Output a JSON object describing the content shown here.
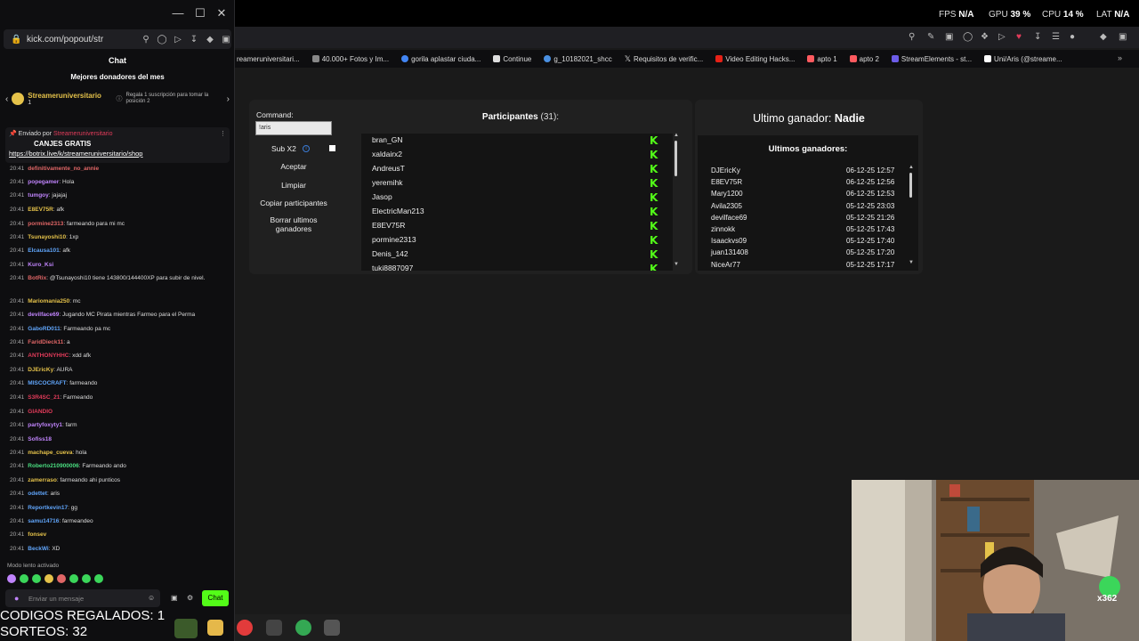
{
  "chat_window": {
    "url": "kick.com/popout/str",
    "header": "Chat",
    "donors_title": "Mejores donadores del mes",
    "donor_name": "Streameruniversitario",
    "donor_count": "1",
    "donor_hint": "Regala 1 suscripción para tomar la posición 2",
    "pinned_prefix": "Enviado por",
    "pinned_user": "Streameruniversitario",
    "pinned_title": "CANJES GRATIS",
    "pinned_link": "https://botrix.live/k/streameruniversitario/shop",
    "messages": [
      {
        "time": "20:41",
        "user": "definitivamente_no_annie",
        "color": "#e06666",
        "text": ""
      },
      {
        "time": "20:41",
        "user": "popegamer",
        "color": "#c084fc",
        "text": "Hola"
      },
      {
        "time": "20:41",
        "user": "tumgoy",
        "color": "#c084fc",
        "text": "jajajaj"
      },
      {
        "time": "20:41",
        "user": "E8EV75R",
        "color": "#e5c24a",
        "text": "afk"
      },
      {
        "time": "20:41",
        "user": "pormine2313",
        "color": "#e06666",
        "text": "farmeando para mi mc"
      },
      {
        "time": "20:41",
        "user": "Tsunayoshi10",
        "color": "#e5c24a",
        "text": "1xp"
      },
      {
        "time": "20:41",
        "user": "Elcausa101",
        "color": "#60a5fa",
        "text": "afk"
      },
      {
        "time": "20:41",
        "user": "Kuro_Ksi",
        "color": "#c084fc",
        "text": ""
      },
      {
        "time": "20:41",
        "user": "BotRix",
        "color": "#e06666",
        "text": "@Tsunayoshi10 tiene 143800/144400XP para subir de nivel."
      },
      {
        "time": "20:41",
        "user": "Mariomania250",
        "color": "#e5c24a",
        "text": "mc"
      },
      {
        "time": "20:41",
        "user": "devilface69",
        "color": "#c084fc",
        "text": "Jugando MC Pirata mientras Farmeo para el Perma"
      },
      {
        "time": "20:41",
        "user": "GaboRD011",
        "color": "#60a5fa",
        "text": "Farmeando pa mc"
      },
      {
        "time": "20:41",
        "user": "FaridDieck11",
        "color": "#e06666",
        "text": "a"
      },
      {
        "time": "20:41",
        "user": "ANTHONYHHC",
        "color": "#e23b5a",
        "text": "xdd afk"
      },
      {
        "time": "20:41",
        "user": "DJEricKy",
        "color": "#e5c24a",
        "text": "AURA"
      },
      {
        "time": "20:41",
        "user": "MISCOCRAFT",
        "color": "#60a5fa",
        "text": "farmeando"
      },
      {
        "time": "20:41",
        "user": "S3R4SC_21",
        "color": "#e23b5a",
        "text": "Farmeando"
      },
      {
        "time": "20:41",
        "user": "GIANDIO",
        "color": "#e23b5a",
        "text": ""
      },
      {
        "time": "20:41",
        "user": "partyfoxyty1",
        "color": "#c084fc",
        "text": "farm"
      },
      {
        "time": "20:41",
        "user": "Sofiss18",
        "color": "#c084fc",
        "text": ""
      },
      {
        "time": "20:41",
        "user": "machape_cueva",
        "color": "#e5c24a",
        "text": "hola"
      },
      {
        "time": "20:41",
        "user": "Roberto210900006",
        "color": "#4ade80",
        "text": "Farmeando ando"
      },
      {
        "time": "20:41",
        "user": "zamerraso",
        "color": "#e5c24a",
        "text": "farmeando ahi punticos"
      },
      {
        "time": "20:41",
        "user": "odettet",
        "color": "#60a5fa",
        "text": "aris"
      },
      {
        "time": "20:41",
        "user": "Reportkevin17",
        "color": "#60a5fa",
        "text": "gg"
      },
      {
        "time": "20:41",
        "user": "samu14716",
        "color": "#60a5fa",
        "text": "farmeandeo"
      },
      {
        "time": "20:41",
        "user": "fonsev",
        "color": "#e5c24a",
        "text": ""
      },
      {
        "time": "20:41",
        "user": "BeckWi",
        "color": "#60a5fa",
        "text": "XD"
      }
    ],
    "slow_mode": "Modo lento activado",
    "send_placeholder": "Enviar un mensaje",
    "chat_button": "Chat"
  },
  "overlay": {
    "codes": "CODIGOS REGALADOS: 1",
    "raffles": "SORTEOS: 32"
  },
  "hardware": {
    "fps_label": "FPS",
    "fps_value": "N/A",
    "gpu_label": "GPU",
    "gpu_value": "39 %",
    "cpu_label": "CPU",
    "cpu_value": "14 %",
    "lat_label": "LAT",
    "lat_value": "N/A"
  },
  "bookmarks": [
    "reameruniversitari...",
    "40.000+ Fotos y Im...",
    "gorila aplastar ciuda...",
    "Continue",
    "g_10182021_shcc",
    "Requisitos de verific...",
    "Video Editing Hacks...",
    "apto 1",
    "apto 2",
    "StreamElements - st...",
    "Uni/Aris (@streame..."
  ],
  "giveaway": {
    "command_label": "Command:",
    "command_value": "!aris",
    "sub_label": "Sub X2",
    "buttons": [
      "Aceptar",
      "Limpiar",
      "Copiar participantes",
      "Borrar ultimos ganadores"
    ],
    "participants_title": "Participantes",
    "participants_count": "(31):",
    "participants": [
      "bran_GN",
      "xaldairx2",
      "AndreusT",
      "yeremihk",
      "Jasop",
      "ElectricMan213",
      "E8EV75R",
      "pormine2313",
      "Denis_142",
      "tuki8887097"
    ],
    "last_winner_label": "Ultimo ganador:",
    "last_winner_value": "Nadie",
    "winners_title": "Ultimos ganadores:",
    "winners": [
      {
        "name": "DJEricKy",
        "date": "06-12-25 12:57"
      },
      {
        "name": "E8EV75R",
        "date": "06-12-25 12:56"
      },
      {
        "name": "Mary1200",
        "date": "06-12-25 12:53"
      },
      {
        "name": "Avila2305",
        "date": "05-12-25 23:03"
      },
      {
        "name": "devilface69",
        "date": "05-12-25 21:26"
      },
      {
        "name": "zinnokk",
        "date": "05-12-25 17:43"
      },
      {
        "name": "Isaackvs09",
        "date": "05-12-25 17:40"
      },
      {
        "name": "juan131408",
        "date": "05-12-25 17:20"
      },
      {
        "name": "NiceAr77",
        "date": "05-12-25 17:17"
      }
    ]
  },
  "webcam": {
    "badge": "x362"
  }
}
